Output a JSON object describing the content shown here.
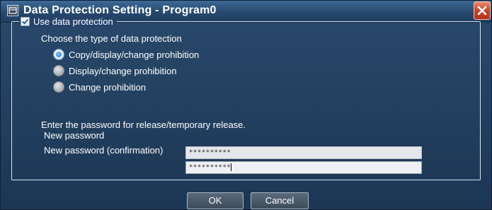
{
  "window": {
    "title": "Data Protection Setting - Program0"
  },
  "protection": {
    "use_label": "Use data protection",
    "use_checked": true,
    "type_heading": "Choose the type of data protection",
    "options": [
      {
        "label": "Copy/display/change prohibition",
        "selected": true
      },
      {
        "label": "Display/change prohibition",
        "selected": false
      },
      {
        "label": "Change prohibition",
        "selected": false
      }
    ]
  },
  "password": {
    "instruction": "Enter the password for release/temporary release.",
    "new_label": "New password",
    "new_value": "**********",
    "confirm_label": "New password (confirmation)",
    "confirm_value": "**********"
  },
  "buttons": {
    "ok": "OK",
    "cancel": "Cancel"
  },
  "icons": {
    "app": "dialog-app-icon",
    "close": "close-icon",
    "check": "checkmark-icon"
  },
  "colors": {
    "background": "#24405e",
    "titlebar": "#26496e",
    "close_button": "#c9432a",
    "text": "#ffffff",
    "field_background": "#e4e6ea"
  }
}
